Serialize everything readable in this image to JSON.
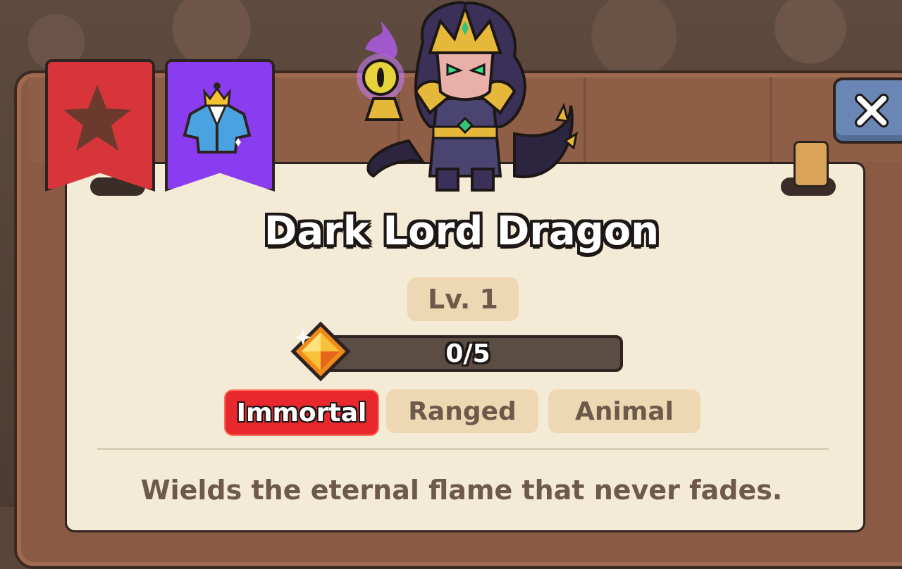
{
  "unit": {
    "name": "Dark Lord Dragon",
    "level": "Lv. 1",
    "shards": "0/5",
    "shard_progress": 0,
    "tags": [
      "Immortal",
      "Ranged",
      "Animal"
    ],
    "description": "Wields the eternal flame that never fades."
  },
  "tabs": [
    {
      "icon": "star-icon",
      "color": "#d8353a"
    },
    {
      "icon": "costume-icon",
      "color": "#8a3cf0"
    }
  ],
  "colors": {
    "immortal_tag": "#e8282c",
    "close_button": "#6a86b4",
    "paper": "#f4ebd7"
  }
}
